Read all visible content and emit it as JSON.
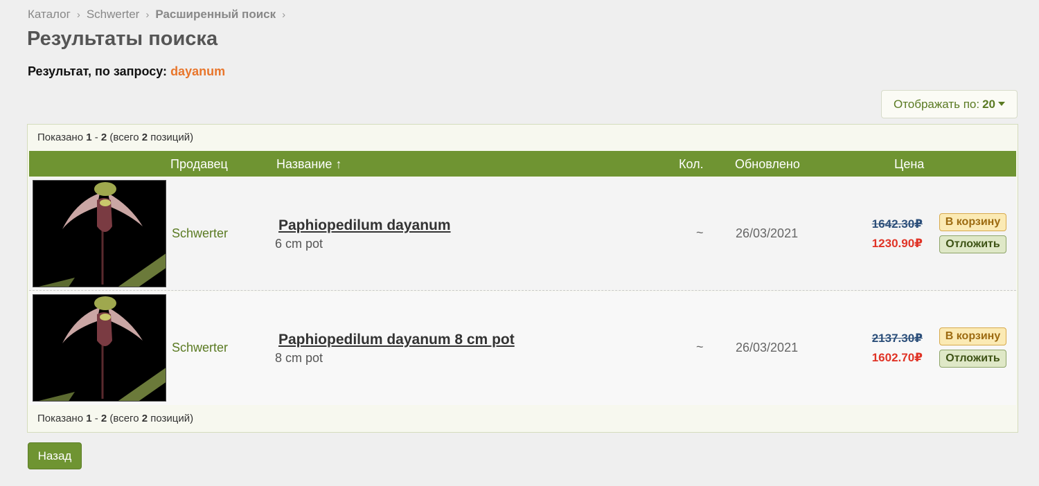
{
  "breadcrumb": {
    "items": [
      "Каталог",
      "Schwerter",
      "Расширенный поиск"
    ],
    "separator": "›"
  },
  "page_title": "Результаты поиска",
  "query": {
    "label": "Результат, по запросу:",
    "value": "dayanum"
  },
  "per_page": {
    "label": "Отображать по:",
    "value": "20"
  },
  "shown": {
    "prefix": "Показано",
    "from": "1",
    "dash": "-",
    "to": "2",
    "total_prefix": "(всего",
    "total": "2",
    "total_suffix": "позиций)"
  },
  "table": {
    "headers": {
      "seller": "Продавец",
      "name": "Название ↑",
      "qty": "Кол.",
      "updated": "Обновлено",
      "price": "Цена"
    },
    "rows": [
      {
        "seller": "Schwerter",
        "name": "Paphiopedilum dayanum",
        "desc": "6 cm pot",
        "qty": "~",
        "updated": "26/03/2021",
        "old_price": "1642.30₽",
        "new_price": "1230.90₽",
        "cart_label": "В корзину",
        "later_label": "Отложить"
      },
      {
        "seller": "Schwerter",
        "name": "Paphiopedilum dayanum 8 cm pot",
        "desc": "8 cm pot",
        "qty": "~",
        "updated": "26/03/2021",
        "old_price": "2137.30₽",
        "new_price": "1602.70₽",
        "cart_label": "В корзину",
        "later_label": "Отложить"
      }
    ]
  },
  "back_label": "Назад",
  "colors": {
    "accent_green": "#6f9432",
    "query_orange": "#e8762c",
    "old_price_blue": "#2c4f7a",
    "new_price_red": "#e03326"
  }
}
